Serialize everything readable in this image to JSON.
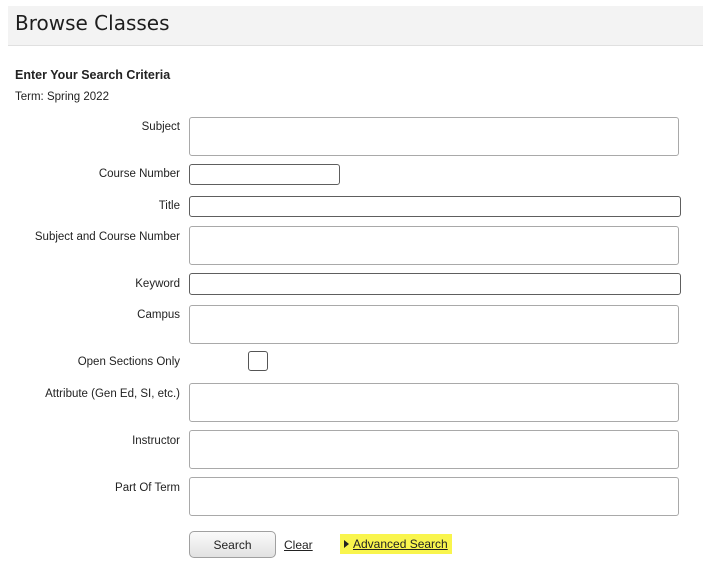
{
  "header": {
    "title": "Browse Classes"
  },
  "form": {
    "section_title": "Enter Your Search Criteria",
    "term": "Term: Spring 2022",
    "labels": {
      "subject": "Subject",
      "course_number": "Course Number",
      "title": "Title",
      "subject_course": "Subject and Course Number",
      "keyword": "Keyword",
      "campus": "Campus",
      "open_sections": "Open Sections Only",
      "attribute": "Attribute (Gen Ed, SI, etc.)",
      "instructor": "Instructor",
      "part_of_term": "Part Of Term"
    },
    "values": {
      "subject": "",
      "course_number": "",
      "title": "",
      "subject_course": "",
      "keyword": "",
      "campus": "",
      "attribute": "",
      "instructor": "",
      "part_of_term": ""
    },
    "open_sections_checked": false
  },
  "actions": {
    "search_label": "Search",
    "clear_label": "Clear",
    "advanced_label": "Advanced Search",
    "advanced_highlight_color": "#f9f54d"
  }
}
